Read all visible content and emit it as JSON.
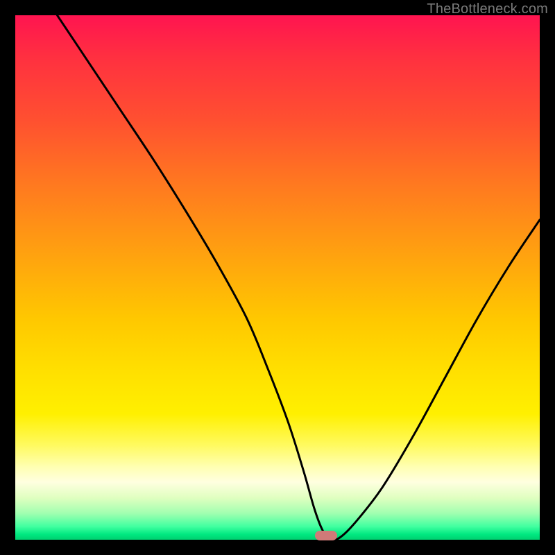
{
  "watermark": "TheBottleneck.com",
  "chart_data": {
    "type": "line",
    "title": "",
    "xlabel": "",
    "ylabel": "",
    "xlim": [
      0,
      100
    ],
    "ylim": [
      0,
      100
    ],
    "grid": false,
    "series": [
      {
        "name": "bottleneck-curve",
        "x": [
          8,
          14,
          20,
          26,
          32,
          38,
          44,
          48,
          52,
          55,
          57,
          58.5,
          60,
          62,
          65,
          70,
          76,
          82,
          88,
          94,
          100
        ],
        "y": [
          100,
          91,
          82,
          73,
          63.5,
          53.5,
          42.5,
          33,
          22.5,
          13,
          6,
          2,
          0,
          0.5,
          3.5,
          10,
          20,
          31,
          42,
          52,
          61
        ]
      }
    ],
    "marker": {
      "name": "optimal-point",
      "x": 59.2,
      "y": 0.8,
      "color": "#d07a78"
    },
    "background_gradient": {
      "top": "#ff1450",
      "bottom": "#00d070"
    }
  }
}
